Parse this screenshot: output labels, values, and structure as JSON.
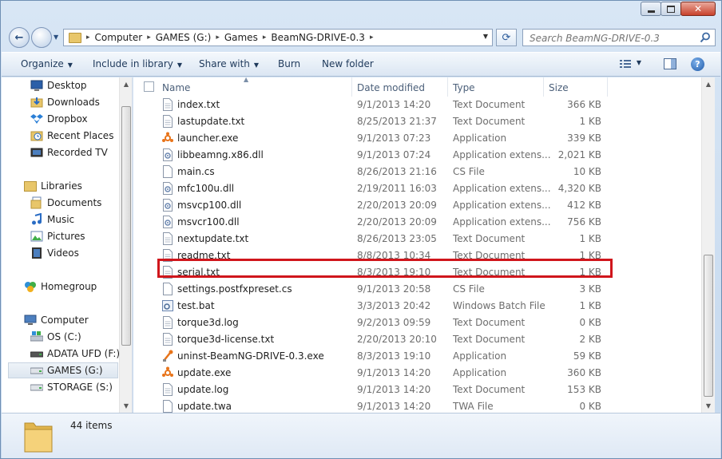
{
  "window": {
    "caption_buttons": [
      "minimize-icon",
      "maximize-icon",
      "close-icon"
    ]
  },
  "address_bar": {
    "breadcrumb": [
      "Computer",
      "GAMES (G:)",
      "Games",
      "BeamNG-DRIVE-0.3"
    ]
  },
  "search": {
    "placeholder": "Search BeamNG-DRIVE-0.3"
  },
  "toolbar": {
    "organize": "Organize",
    "include_in_library": "Include in library",
    "share_with": "Share with",
    "burn": "Burn",
    "new_folder": "New folder"
  },
  "nav": {
    "favorites": [
      {
        "label": "Desktop",
        "icon": "desktop-icon"
      },
      {
        "label": "Downloads",
        "icon": "downloads-icon"
      },
      {
        "label": "Dropbox",
        "icon": "dropbox-icon"
      },
      {
        "label": "Recent Places",
        "icon": "recent-places-icon"
      },
      {
        "label": "Recorded TV",
        "icon": "recorded-tv-icon"
      }
    ],
    "libraries_label": "Libraries",
    "libraries": [
      {
        "label": "Documents",
        "icon": "documents-icon"
      },
      {
        "label": "Music",
        "icon": "music-icon"
      },
      {
        "label": "Pictures",
        "icon": "pictures-icon"
      },
      {
        "label": "Videos",
        "icon": "videos-icon"
      }
    ],
    "homegroup_label": "Homegroup",
    "computer_label": "Computer",
    "drives": [
      {
        "label": "OS (C:)",
        "icon": "windows-drive-icon"
      },
      {
        "label": "ADATA UFD (F:)",
        "icon": "usb-drive-icon"
      },
      {
        "label": "GAMES (G:)",
        "icon": "hard-drive-icon",
        "selected": true
      },
      {
        "label": "STORAGE (S:)",
        "icon": "hard-drive-icon"
      }
    ]
  },
  "columns": {
    "name": "Name",
    "date_modified": "Date modified",
    "type": "Type",
    "size": "Size"
  },
  "files": [
    {
      "name": "index.txt",
      "date": "9/1/2013 14:20",
      "type": "Text Document",
      "size": "366 KB",
      "icon": "text-file-icon"
    },
    {
      "name": "lastupdate.txt",
      "date": "8/25/2013 21:37",
      "type": "Text Document",
      "size": "1 KB",
      "icon": "text-file-icon"
    },
    {
      "name": "launcher.exe",
      "date": "9/1/2013 07:23",
      "type": "Application",
      "size": "339 KB",
      "icon": "app-icon"
    },
    {
      "name": "libbeamng.x86.dll",
      "date": "9/1/2013 07:24",
      "type": "Application extens...",
      "size": "2,021 KB",
      "icon": "dll-icon"
    },
    {
      "name": "main.cs",
      "date": "8/26/2013 21:16",
      "type": "CS File",
      "size": "10 KB",
      "icon": "file-icon"
    },
    {
      "name": "mfc100u.dll",
      "date": "2/19/2011 16:03",
      "type": "Application extens...",
      "size": "4,320 KB",
      "icon": "dll-icon"
    },
    {
      "name": "msvcp100.dll",
      "date": "2/20/2013 20:09",
      "type": "Application extens...",
      "size": "412 KB",
      "icon": "dll-icon"
    },
    {
      "name": "msvcr100.dll",
      "date": "2/20/2013 20:09",
      "type": "Application extens...",
      "size": "756 KB",
      "icon": "dll-icon"
    },
    {
      "name": "nextupdate.txt",
      "date": "8/26/2013 23:05",
      "type": "Text Document",
      "size": "1 KB",
      "icon": "text-file-icon"
    },
    {
      "name": "readme.txt",
      "date": "8/8/2013 10:34",
      "type": "Text Document",
      "size": "1 KB",
      "icon": "text-file-icon"
    },
    {
      "name": "serial.txt",
      "date": "8/3/2013 19:10",
      "type": "Text Document",
      "size": "1 KB",
      "icon": "text-file-icon",
      "highlighted": true
    },
    {
      "name": "settings.postfxpreset.cs",
      "date": "9/1/2013 20:58",
      "type": "CS File",
      "size": "3 KB",
      "icon": "file-icon"
    },
    {
      "name": "test.bat",
      "date": "3/3/2013 20:42",
      "type": "Windows Batch File",
      "size": "1 KB",
      "icon": "batch-file-icon"
    },
    {
      "name": "torque3d.log",
      "date": "9/2/2013 09:59",
      "type": "Text Document",
      "size": "0 KB",
      "icon": "text-file-icon"
    },
    {
      "name": "torque3d-license.txt",
      "date": "2/20/2013 20:10",
      "type": "Text Document",
      "size": "2 KB",
      "icon": "text-file-icon"
    },
    {
      "name": "uninst-BeamNG-DRIVE-0.3.exe",
      "date": "8/3/2013 19:10",
      "type": "Application",
      "size": "59 KB",
      "icon": "uninstall-icon"
    },
    {
      "name": "update.exe",
      "date": "9/1/2013 14:20",
      "type": "Application",
      "size": "360 KB",
      "icon": "app-icon"
    },
    {
      "name": "update.log",
      "date": "9/1/2013 14:20",
      "type": "Text Document",
      "size": "153 KB",
      "icon": "text-file-icon"
    },
    {
      "name": "update.twa",
      "date": "9/1/2013 14:20",
      "type": "TWA File",
      "size": "0 KB",
      "icon": "file-icon"
    }
  ],
  "details": {
    "item_count": "44 items",
    "icon": "folder-icon"
  },
  "colors": {
    "highlight_border": "#d0161c",
    "toolbar_text": "#1e395b",
    "window_frame": "#c4d8ee"
  }
}
